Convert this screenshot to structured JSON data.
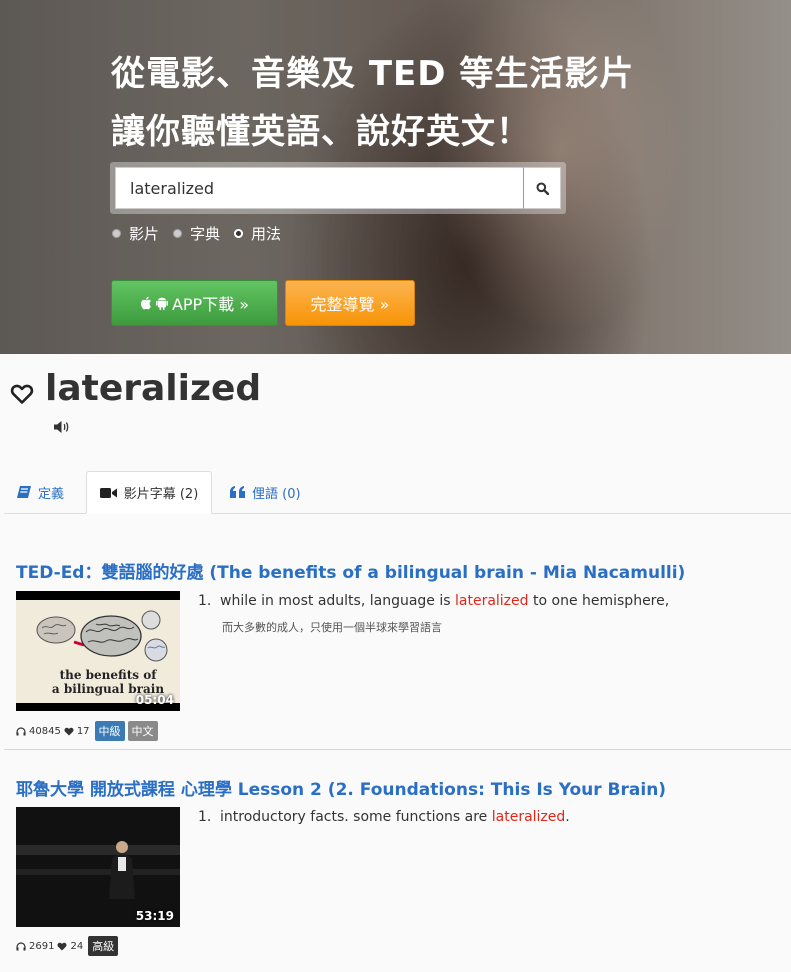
{
  "hero": {
    "title_line1": "從電影、音樂及 TED 等生活影片",
    "title_line2": "讓你聽懂英語、說好英文！",
    "search": {
      "value": "lateralized",
      "icon": "search-icon"
    },
    "modes": [
      {
        "label": "影片",
        "checked": false
      },
      {
        "label": "字典",
        "checked": false
      },
      {
        "label": "用法",
        "checked": true
      }
    ],
    "app_button": "APP下載 »",
    "guide_button": "完整導覽 »"
  },
  "word": {
    "title": "lateralized"
  },
  "tabs": [
    {
      "label": "定義",
      "icon": "book-icon"
    },
    {
      "label": "影片字幕 (2)",
      "icon": "video-camera-icon",
      "active": true
    },
    {
      "label": "俚語 (0)",
      "icon": "quote-icon"
    }
  ],
  "results": [
    {
      "title": "TED-Ed：雙語腦的好處 (The benefits of a bilingual brain - Mia Nacamulli)",
      "thumb_caption_line1": "the benefits of",
      "thumb_caption_line2": "a bilingual brain",
      "duration": "05:04",
      "listens": "40845",
      "likes": "17",
      "badges": [
        {
          "label": "中級",
          "color": "#3a7bb5"
        },
        {
          "label": "中文",
          "color": "#8a8a8a"
        }
      ],
      "sentence": {
        "num": "1.",
        "before": "while in most adults, language is ",
        "highlight": "lateralized",
        "after": " to one hemisphere,"
      },
      "translation": "而大多數的成人，只使用一個半球來學習語言"
    },
    {
      "title": "耶魯大學 開放式課程 心理學 Lesson 2 (2. Foundations: This Is Your Brain)",
      "duration": "53:19",
      "listens": "2691",
      "likes": "24",
      "badges": [
        {
          "label": "高級",
          "color": "#333333"
        }
      ],
      "sentence": {
        "num": "1.",
        "before": "introductory facts. some functions are ",
        "highlight": "lateralized",
        "after": "."
      }
    }
  ]
}
